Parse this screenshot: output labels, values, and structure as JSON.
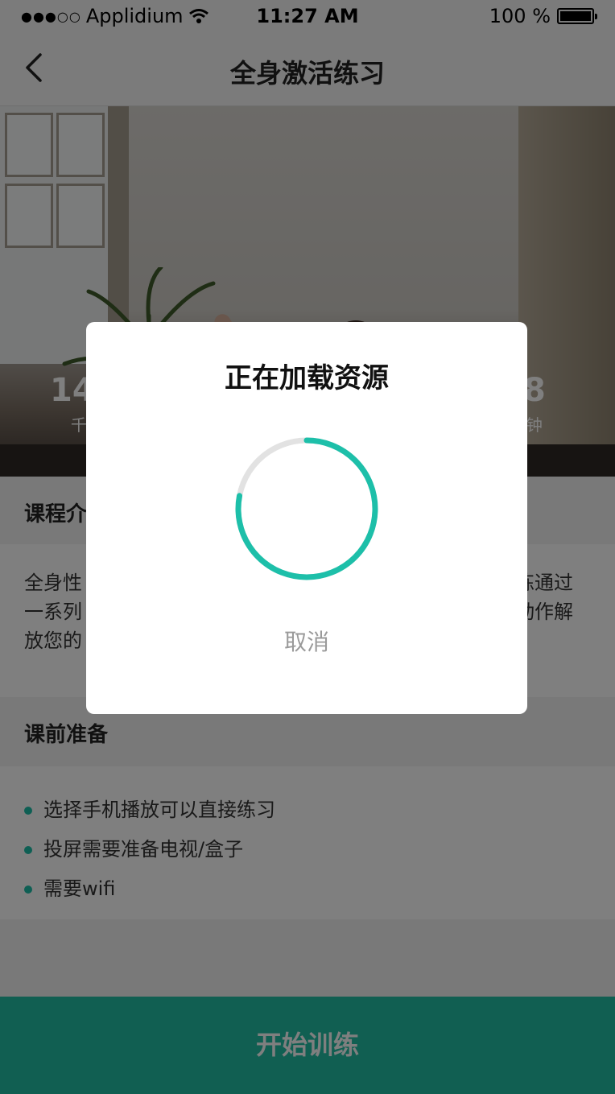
{
  "status_bar": {
    "signal": "●●●○○",
    "carrier": "Applidium",
    "wifi_icon": "wifi-icon",
    "time": "11:27 AM",
    "battery": "100 %",
    "battery_level": 1.0
  },
  "nav": {
    "back_icon": "chevron-left-icon",
    "title": "全身激活练习"
  },
  "hero": {
    "stats": [
      {
        "value": "14",
        "label": "千"
      },
      {
        "value": "8",
        "label": "钟"
      }
    ]
  },
  "intro": {
    "header": "课程介",
    "lines": [
      "全身性",
      "一系列",
      "放您的"
    ],
    "right_lines": [
      "练通过",
      "动作解"
    ]
  },
  "prep": {
    "header": "课前准备",
    "items": [
      "选择手机播放可以直接练习",
      "投屏需要准备电视/盒子",
      "需要wifi"
    ]
  },
  "start_button": "开始训练",
  "dialog": {
    "title": "正在加载资源",
    "progress": 0.78,
    "cancel": "取消"
  },
  "colors": {
    "accent": "#22bfa5",
    "spinner_track": "#e2e2e2",
    "spinner_arc": "#1dbfa9"
  }
}
